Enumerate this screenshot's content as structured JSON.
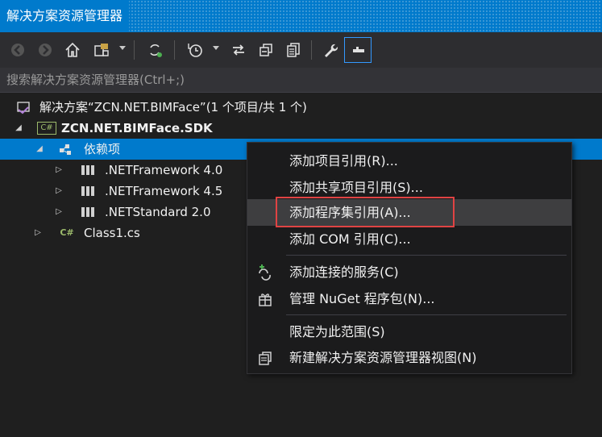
{
  "window": {
    "title": "解决方案资源管理器"
  },
  "toolbar": {
    "icons": [
      "back-icon",
      "forward-icon",
      "home-icon",
      "switch-views-icon",
      "sync-icon",
      "pending-changes-icon",
      "sync-active-doc-icon",
      "collapse-all-icon",
      "show-all-files-icon",
      "properties-icon",
      "preview-icon"
    ]
  },
  "search": {
    "placeholder": "搜索解决方案资源管理器(Ctrl+;)"
  },
  "tree": {
    "solution": "解决方案“ZCN.NET.BIMFace”(1 个项目/共 1 个)",
    "project": "ZCN.NET.BIMFace.SDK",
    "dependencies": "依赖项",
    "frameworks": [
      ".NETFramework 4.0",
      ".NETFramework 4.5",
      ".NETStandard 2.0"
    ],
    "file": "Class1.cs",
    "csharp_badge": "C#"
  },
  "context_menu": {
    "items": [
      "添加项目引用(R)...",
      "添加共享项目引用(S)...",
      "添加程序集引用(A)...",
      "添加 COM 引用(C)...",
      "添加连接的服务(C)",
      "管理 NuGet 程序包(N)...",
      "限定为此范围(S)",
      "新建解决方案资源管理器视图(N)"
    ],
    "highlighted": "添加程序集引用(A)..."
  },
  "colors": {
    "accent": "#007acc",
    "highlight_border": "#e04343"
  }
}
